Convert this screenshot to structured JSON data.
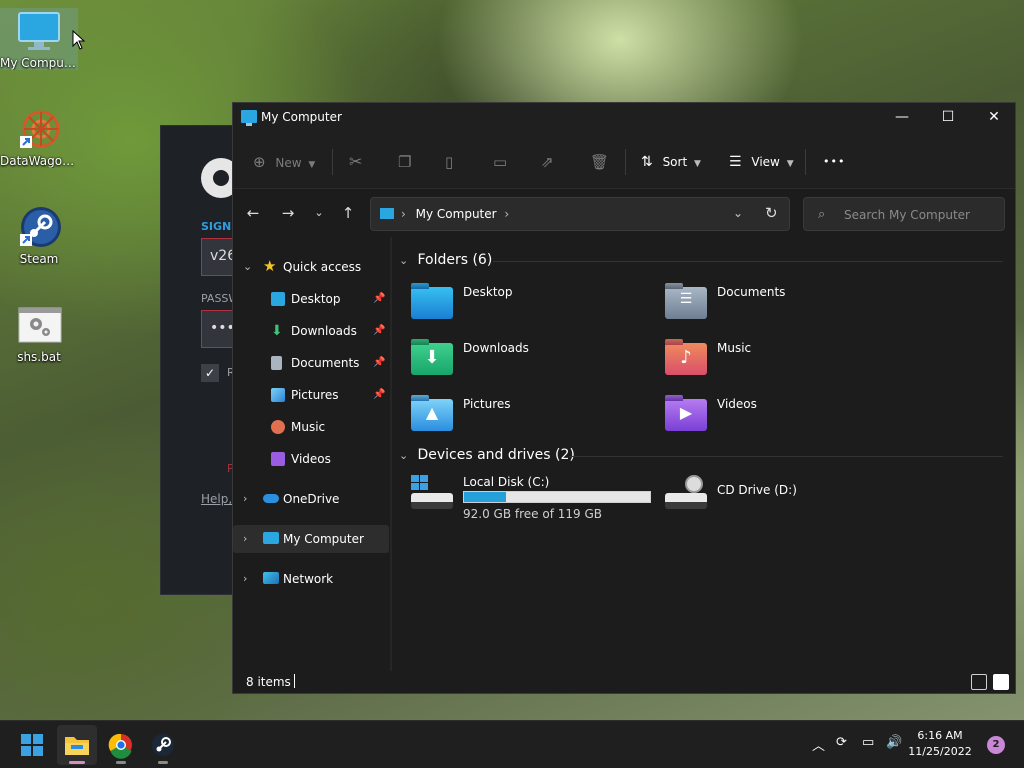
{
  "desktop": {
    "icons": [
      {
        "label": "My Computer"
      },
      {
        "label": "DataWagon..."
      },
      {
        "label": "Steam"
      },
      {
        "label": "shs.bat"
      }
    ]
  },
  "steam": {
    "sign_label": "SIGN",
    "user_value": "v26",
    "pass_label": "PASSW",
    "pass_value": "•••••",
    "remember_short": "R",
    "p_short": "P",
    "help_link": "Help,"
  },
  "explorer": {
    "title": "My Computer",
    "window_controls": {
      "minimize": "—",
      "maximize": "☐",
      "close": "✕"
    },
    "commands": {
      "new_label": "New",
      "sort_label": "Sort",
      "view_label": "View",
      "more_label": "•••"
    },
    "address": {
      "path": "My Computer"
    },
    "search": {
      "placeholder": "Search My Computer"
    },
    "sidebar": {
      "quick_access": "Quick access",
      "items": [
        {
          "label": "Desktop"
        },
        {
          "label": "Downloads"
        },
        {
          "label": "Documents"
        },
        {
          "label": "Pictures"
        },
        {
          "label": "Music"
        },
        {
          "label": "Videos"
        }
      ],
      "onedrive": "OneDrive",
      "my_computer": "My Computer",
      "network": "Network"
    },
    "folders": {
      "header": "Folders (6)",
      "items": [
        {
          "name": "Desktop"
        },
        {
          "name": "Documents"
        },
        {
          "name": "Downloads"
        },
        {
          "name": "Music"
        },
        {
          "name": "Pictures"
        },
        {
          "name": "Videos"
        }
      ]
    },
    "drives": {
      "header": "Devices and drives (2)",
      "items": [
        {
          "name": "Local Disk (C:)",
          "free_text": "92.0 GB free of 119 GB",
          "used_fraction": 0.227
        },
        {
          "name": "CD Drive (D:)"
        }
      ]
    },
    "status": {
      "items_text": "8 items"
    }
  },
  "taskbar": {
    "time": "6:16 AM",
    "date": "11/25/2022",
    "notification_count": "2"
  }
}
